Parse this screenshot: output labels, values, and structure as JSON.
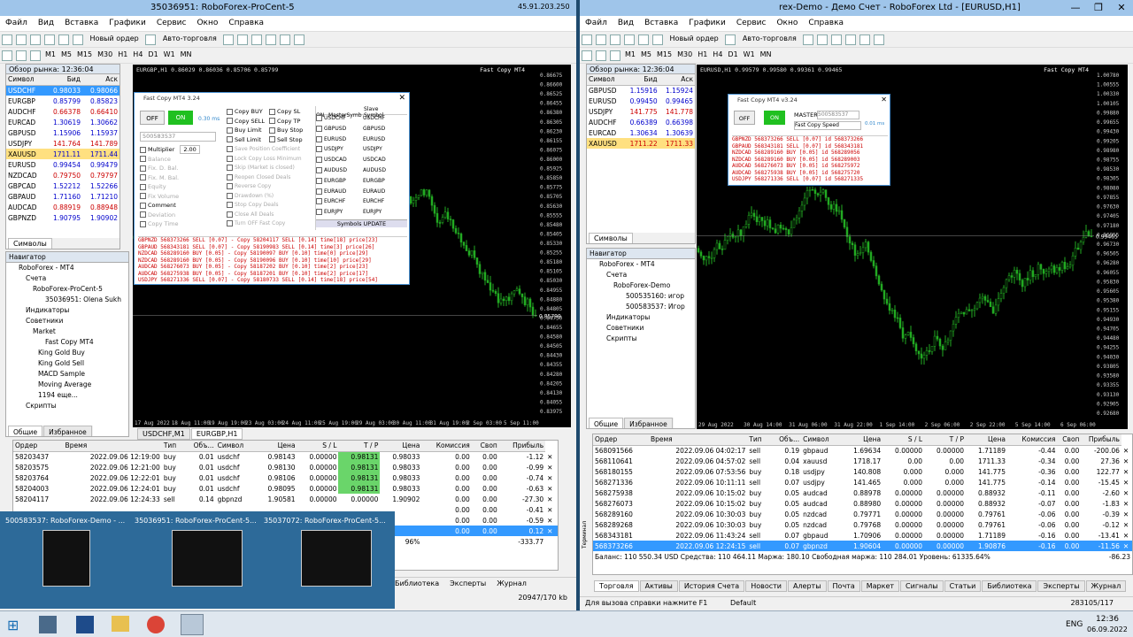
{
  "colors": {
    "accent": "#3399ff",
    "green": "#22aa22",
    "red": "#cc0000"
  },
  "left": {
    "title": "35036951: RoboForex-ProCent-5",
    "ip": "45.91.203.250",
    "menu": [
      "Файл",
      "Вид",
      "Вставка",
      "Графики",
      "Сервис",
      "Окно",
      "Справка"
    ],
    "new_order": "Новый ордер",
    "auto": "Авто-торговля",
    "tfs": [
      "M1",
      "M5",
      "M15",
      "M30",
      "H1",
      "H4",
      "D1",
      "W1",
      "MN"
    ],
    "market_watch": {
      "title": "Обзор рынка: 12:36:04",
      "cols": [
        "Символ",
        "Бид",
        "Аск"
      ],
      "rows": [
        [
          "USDCHF",
          "0.98033",
          "0.98066"
        ],
        [
          "EURGBP",
          "0.85799",
          "0.85823"
        ],
        [
          "AUDCHF",
          "0.66378",
          "0.66410"
        ],
        [
          "EURCAD",
          "1.30619",
          "1.30662"
        ],
        [
          "GBPUSD",
          "1.15906",
          "1.15937"
        ],
        [
          "USDJPY",
          "141.764",
          "141.789"
        ],
        [
          "XAUUSD",
          "1711.11",
          "1711.44"
        ],
        [
          "EURUSD",
          "0.99454",
          "0.99479"
        ],
        [
          "NZDCAD",
          "0.79750",
          "0.79797"
        ],
        [
          "GBPCAD",
          "1.52212",
          "1.52266"
        ],
        [
          "GBPAUD",
          "1.71160",
          "1.71210"
        ],
        [
          "AUDCAD",
          "0.88919",
          "0.88948"
        ],
        [
          "GBPNZD",
          "1.90795",
          "1.90902"
        ]
      ],
      "tabs": [
        "Символы",
        "Тиковый график"
      ]
    },
    "navigator": {
      "title": "Навигатор",
      "items": [
        "RoboForex - MT4",
        "Счета",
        "RoboForex-ProCent-5",
        "35036951: Olena Sukh",
        "Индикаторы",
        "Советники",
        "Market",
        "Fast Copy MT4",
        "King Gold Buy",
        "King Gold Sell",
        "MACD Sample",
        "Moving Average",
        "1194 еще...",
        "Скрипты"
      ],
      "tabs": [
        "Общие",
        "Избранное"
      ]
    },
    "chart": {
      "header": "EURGBP,H1 0.86029 0.86036 0.85706 0.85799",
      "name": "Fast Copy MT4",
      "price": "0.85799",
      "yticks": [
        "0.86675",
        "0.86600",
        "0.86525",
        "0.86455",
        "0.86380",
        "0.86305",
        "0.86230",
        "0.86155",
        "0.86075",
        "0.86000",
        "0.85925",
        "0.85850",
        "0.85775",
        "0.85705",
        "0.85630",
        "0.85555",
        "0.85480",
        "0.85405",
        "0.85330",
        "0.85255",
        "0.85180",
        "0.85105",
        "0.85030",
        "0.84955",
        "0.84880",
        "0.84805",
        "0.84730",
        "0.84655",
        "0.84580",
        "0.84505",
        "0.84430",
        "0.84355",
        "0.84280",
        "0.84205",
        "0.84130",
        "0.84055",
        "0.83975"
      ],
      "xticks": [
        "17 Aug 2022",
        "18 Aug 11:00",
        "19 Aug 19:00",
        "23 Aug 03:00",
        "24 Aug 11:00",
        "25 Aug 19:00",
        "29 Aug 03:00",
        "30 Aug 11:00",
        "31 Aug 19:00",
        "2 Sep 03:00",
        "5 Sep 11:00"
      ],
      "tabs": [
        "USDCHF,M1",
        "EURGBP,H1"
      ]
    },
    "dialog": {
      "title": "Fast Copy MT4 3.24",
      "off": "OFF",
      "on": "ON",
      "ms": "0.30 ms",
      "account": "500583537",
      "opts": [
        "Multiplier",
        "Balance",
        "Fix. D. Bal.",
        "Fix. M. Bal.",
        "Equity",
        "Fix Volume",
        "Comment",
        "Deviation",
        "Copy Time"
      ],
      "mult": "2.00",
      "checks": [
        "Copy BUY",
        "Copy SELL",
        "Buy Limit",
        "Sell Limit",
        "Copy SL",
        "Copy TP",
        "Buy Stop",
        "Sell Stop"
      ],
      "greyopts": [
        "Save Position Coefficient",
        "Lock Copy Loss Minimum",
        "Skip (Market is closed)",
        "Reopen Closed Deals",
        "Reverse Copy",
        "Drawdown (%)",
        "Stop Copy Deals",
        "Close All Deals",
        "Turn OFF Fast Copy"
      ],
      "sym_head": [
        "ON",
        "MasterSymb",
        "Slave Symbol"
      ],
      "syms": [
        "USDCHF",
        "GBPUSD",
        "EURUSD",
        "USDJPY",
        "USDCAD",
        "AUDUSD",
        "EURGBP",
        "EURAUD",
        "EURCHF",
        "EURJPY"
      ],
      "sym_update": "Symbols UPDATE",
      "log": [
        "GBPNZD  568373266 SELL [0.07] - Copy 58204117 SELL [0.14] time[18] price[23]",
        "GBPAUD  568343181 SELL [0.07] - Copy 58190983 SELL [0.14] time[3] price[26]",
        "NZDCAD  568289160 BUY [0.05] - Copy 58190097 BUY [0.10] time[0] price[29]",
        "NZDCAD  568289160 BUY [0.05] - Copy 58190096 BUY [0.10] time[10] price[29]",
        "AUDCAD  568276073 BUY [0.05] - Copy 58187202 BUY [0.10] time[2] price[23]",
        "AUDCAD  568275938 BUY [0.05] - Copy 58187201 BUY [0.10] time[2] price[17]",
        "USDJPY  568271336 SELL [0.07] - Copy 58180733 SELL [0.14] time[18] price[54]"
      ]
    },
    "terminal": {
      "cols": [
        "Ордер",
        "Время",
        "Тип",
        "Объ...",
        "Символ",
        "Цена",
        "S / L",
        "T / P",
        "Цена",
        "Комиссия",
        "Своп",
        "Прибыль"
      ],
      "rows": [
        [
          "58203437",
          "2022.09.06 12:19:00",
          "buy",
          "0.01",
          "usdchf",
          "0.98143",
          "0.00000",
          "0.98131",
          "0.98033",
          "0.00",
          "0.00",
          "-1.12"
        ],
        [
          "58203575",
          "2022.09.06 12:21:00",
          "buy",
          "0.01",
          "usdchf",
          "0.98130",
          "0.00000",
          "0.98131",
          "0.98033",
          "0.00",
          "0.00",
          "-0.99"
        ],
        [
          "58203764",
          "2022.09.06 12:22:01",
          "buy",
          "0.01",
          "usdchf",
          "0.98106",
          "0.00000",
          "0.98131",
          "0.98033",
          "0.00",
          "0.00",
          "-0.74"
        ],
        [
          "58204003",
          "2022.09.06 12:24:01",
          "buy",
          "0.01",
          "usdchf",
          "0.98095",
          "0.00000",
          "0.98131",
          "0.98033",
          "0.00",
          "0.00",
          "-0.63"
        ],
        [
          "58204117",
          "2022.09.06 12:24:33",
          "sell",
          "0.14",
          "gbpnzd",
          "1.90581",
          "0.00000",
          "0.00000",
          "1.90902",
          "0.00",
          "0.00",
          "-27.30"
        ],
        [
          "",
          "",
          "",
          "",
          "",
          "",
          "",
          "",
          "",
          "0.00",
          "0.00",
          "-0.41"
        ],
        [
          "",
          "",
          "",
          "",
          "",
          "",
          "",
          "",
          "",
          "0.00",
          "0.00",
          "-0.59"
        ],
        [
          "",
          "",
          "",
          "",
          "",
          "",
          "",
          "",
          "",
          "0.00",
          "0.00",
          "0.12"
        ]
      ],
      "total_pct": "96%",
      "total": "-333.77",
      "tabs": [
        "Библиотека",
        "Эксперты",
        "Журнал"
      ],
      "traffic": "20947/170 kb"
    },
    "thumbs": [
      "500583537: RoboForex-Demo - ...",
      "35036951: RoboForex-ProCent-5...",
      "35037072: RoboForex-ProCent-5..."
    ]
  },
  "right": {
    "title": "500583537: RoboForex-Demo - Демо Счет - RoboForex Ltd - [EURUSD,H1]",
    "title_vis": "rex-Demo - Демо Счет - RoboForex Ltd - [EURUSD,H1]",
    "menu": [
      "Файл",
      "Вид",
      "Вставка",
      "Графики",
      "Сервис",
      "Окно",
      "Справка"
    ],
    "new_order": "Новый ордер",
    "auto": "Авто-торговля",
    "tfs": [
      "M1",
      "M5",
      "M15",
      "M30",
      "H1",
      "H4",
      "D1",
      "W1",
      "MN"
    ],
    "market_watch": {
      "title": "Обзор рынка: 12:36:04",
      "cols": [
        "Символ",
        "Бид",
        "Аск"
      ],
      "rows": [
        [
          "GBPUSD",
          "1.15916",
          "1.15924"
        ],
        [
          "EURUSD",
          "0.99450",
          "0.99465"
        ],
        [
          "USDJPY",
          "141.775",
          "141.778"
        ],
        [
          "AUDCHF",
          "0.66389",
          "0.66398"
        ],
        [
          "EURCAD",
          "1.30634",
          "1.30639"
        ],
        [
          "XAUUSD",
          "1711.22",
          "1711.33"
        ]
      ],
      "tabs": [
        "Символы",
        "Тиковый график"
      ]
    },
    "navigator": {
      "title": "Навигатор",
      "items": [
        "RoboForex - MT4",
        "Счета",
        "RoboForex-Demo",
        "500535160: игор",
        "500583537: Игор",
        "Индикаторы",
        "Советники",
        "Скрипты"
      ],
      "tabs": [
        "Общие",
        "Избранное"
      ]
    },
    "chart": {
      "header": "EURUSD,H1 0.99579 0.99580 0.99361 0.99465",
      "name": "Fast Copy MT4",
      "price": "0.99465",
      "yticks": [
        "1.00780",
        "1.00555",
        "1.00330",
        "1.00105",
        "0.99880",
        "0.99655",
        "0.99430",
        "0.99205",
        "0.98980",
        "0.98755",
        "0.98530",
        "0.98305",
        "0.98080",
        "0.97855",
        "0.97630",
        "0.97405",
        "0.97180",
        "0.96955",
        "0.96730",
        "0.96505",
        "0.96280",
        "0.96055",
        "0.95830",
        "0.95605",
        "0.95380",
        "0.95155",
        "0.94930",
        "0.94705",
        "0.94480",
        "0.94255",
        "0.94030",
        "0.93805",
        "0.93580",
        "0.93355",
        "0.93130",
        "0.92905",
        "0.92680"
      ],
      "xticks": [
        "29 Aug 2022",
        "30 Aug 14:00",
        "31 Aug 06:00",
        "31 Aug 22:00",
        "1 Sep 14:00",
        "2 Sep 06:00",
        "2 Sep 22:00",
        "5 Sep 14:00",
        "6 Sep 06:00"
      ]
    },
    "dialog": {
      "title": "Fast Copy MT4 v3.24",
      "off": "OFF",
      "on": "ON",
      "master": "MASTER",
      "account": "500583537",
      "speed": "Fast Copy Speed",
      "ms": "0.01 ms",
      "log": [
        "GBPNZD  568373266 SELL [0.07] id 568373266",
        "GBPAUD  568343181 SELL [0.07] id 568343181",
        "NZDCAD  568289160 BUY [0.05] id 568289056",
        "NZDCAD  568289160 BUY [0.05] id 568289003",
        "AUDCAD  568276073 BUY [0.05] id 568275972",
        "AUDCAD  568275938 BUY [0.05] id 568275720",
        "USDJPY  568271336 SELL [0.07] id 568271335"
      ]
    },
    "terminal": {
      "cols": [
        "Ордер",
        "Время",
        "Тип",
        "Объ...",
        "Символ",
        "Цена",
        "S / L",
        "T / P",
        "Цена",
        "Комиссия",
        "Своп",
        "Прибыль"
      ],
      "rows": [
        [
          "568091566",
          "2022.09.06 04:02:17",
          "sell",
          "0.19",
          "gbpaud",
          "1.69634",
          "0.00000",
          "0.00000",
          "1.71189",
          "-0.44",
          "0.00",
          "-200.06"
        ],
        [
          "568110641",
          "2022.09.06 04:57:02",
          "sell",
          "0.04",
          "xauusd",
          "1718.17",
          "0.00",
          "0.00",
          "1711.33",
          "-0.34",
          "0.00",
          "27.36"
        ],
        [
          "568180155",
          "2022.09.06 07:53:56",
          "buy",
          "0.18",
          "usdjpy",
          "140.808",
          "0.000",
          "0.000",
          "141.775",
          "-0.36",
          "0.00",
          "122.77"
        ],
        [
          "568271336",
          "2022.09.06 10:11:11",
          "sell",
          "0.07",
          "usdjpy",
          "141.465",
          "0.000",
          "0.000",
          "141.775",
          "-0.14",
          "0.00",
          "-15.45"
        ],
        [
          "568275938",
          "2022.09.06 10:15:02",
          "buy",
          "0.05",
          "audcad",
          "0.88978",
          "0.00000",
          "0.00000",
          "0.88932",
          "-0.11",
          "0.00",
          "-2.60"
        ],
        [
          "568276073",
          "2022.09.06 10:15:02",
          "buy",
          "0.05",
          "audcad",
          "0.88980",
          "0.00000",
          "0.00000",
          "0.88932",
          "-0.07",
          "0.00",
          "-1.83"
        ],
        [
          "568289160",
          "2022.09.06 10:30:03",
          "buy",
          "0.05",
          "nzdcad",
          "0.79771",
          "0.00000",
          "0.00000",
          "0.79761",
          "-0.06",
          "0.00",
          "-0.39"
        ],
        [
          "568289268",
          "2022.09.06 10:30:03",
          "buy",
          "0.05",
          "nzdcad",
          "0.79768",
          "0.00000",
          "0.00000",
          "0.79761",
          "-0.06",
          "0.00",
          "-0.12"
        ],
        [
          "568343181",
          "2022.09.06 11:43:24",
          "sell",
          "0.07",
          "gbpaud",
          "1.70906",
          "0.00000",
          "0.00000",
          "1.71189",
          "-0.16",
          "0.00",
          "-13.41"
        ],
        [
          "568373266",
          "2022.09.06 12:24:15",
          "sell",
          "0.07",
          "gbpnzd",
          "1.90604",
          "0.00000",
          "0.00000",
          "1.90876",
          "-0.16",
          "0.00",
          "-11.56"
        ]
      ],
      "balance": "Баланс: 110 550.34 USD  Средства: 110 464.11  Маржа: 180.10  Свободная маржа: 110 284.01  Уровень: 61335.64%",
      "total": "-86.23",
      "tabs": [
        "Торговля",
        "Активы",
        "История Счета",
        "Новости",
        "Алерты",
        "Почта",
        "Маркет",
        "Сигналы",
        "Статьи",
        "Библиотека",
        "Эксперты",
        "Журнал"
      ],
      "side": "Терминал",
      "help": "Для вызова справки нажмите F1",
      "default": "Default",
      "traffic": "283105/117"
    }
  },
  "taskbar": {
    "time": "12:36",
    "date": "06.09.2022",
    "lang": "ENG"
  }
}
